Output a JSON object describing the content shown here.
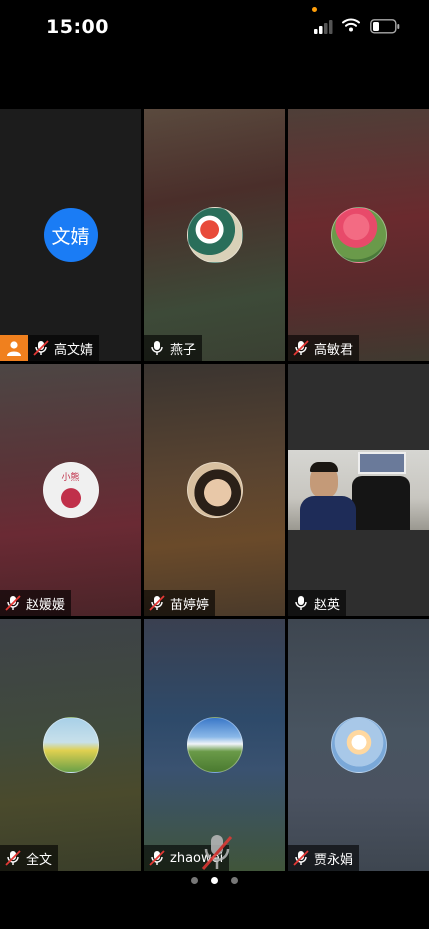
{
  "status_bar": {
    "time": "15:00"
  },
  "participants": [
    {
      "name": "高文婧",
      "avatar_text": "文婧",
      "mic": "muted",
      "host_badge": true
    },
    {
      "name": "燕子",
      "mic": "on"
    },
    {
      "name": "高敏君",
      "mic": "muted"
    },
    {
      "name": "赵媛媛",
      "mic": "muted",
      "avatar_caption": "小熊"
    },
    {
      "name": "苗婷婷",
      "mic": "muted"
    },
    {
      "name": "赵英",
      "mic": "on",
      "video": true
    },
    {
      "name": "全文",
      "mic": "muted"
    },
    {
      "name": "zhaowei",
      "mic": "muted"
    },
    {
      "name": "贾永娟",
      "mic": "muted"
    }
  ],
  "pager": {
    "pages": 3,
    "current": 2
  },
  "colors": {
    "avatar_blue": "#1a7cf5",
    "host_orange": "#f0801e"
  }
}
